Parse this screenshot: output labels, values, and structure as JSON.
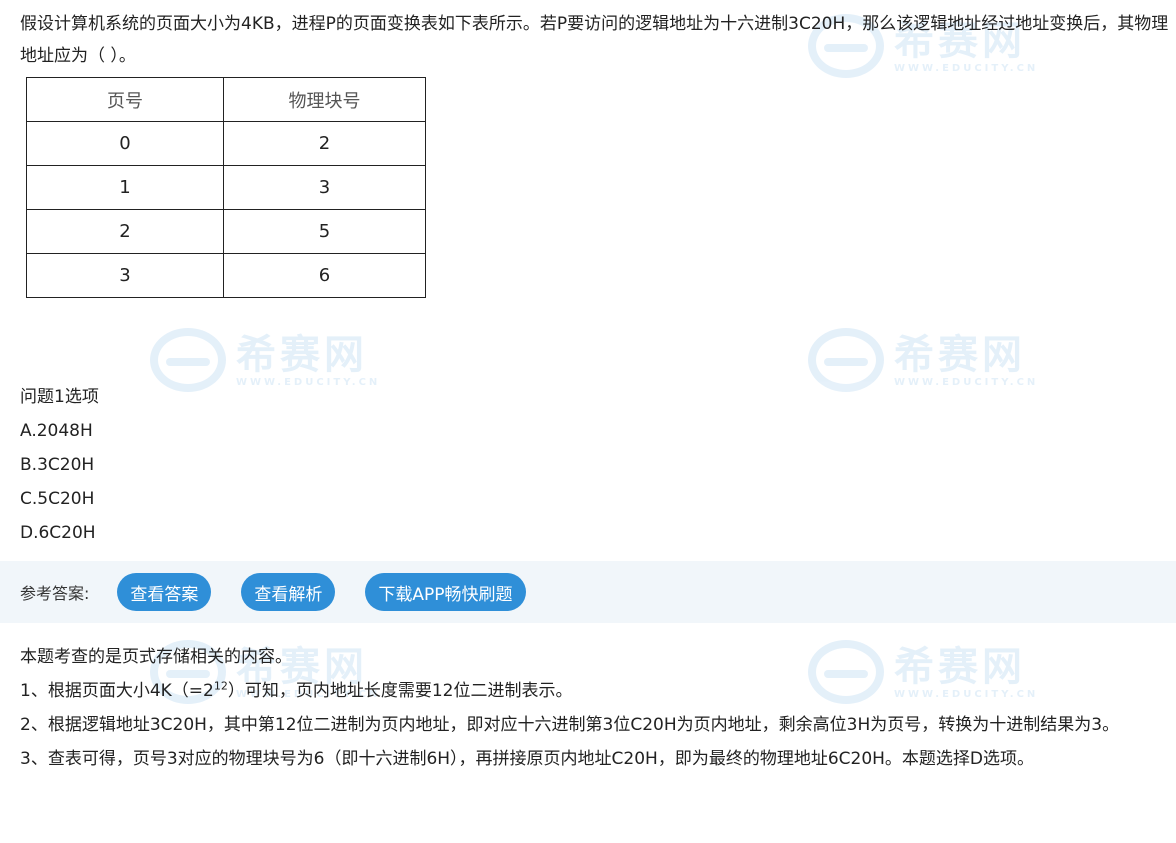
{
  "question": {
    "text": "假设计算机系统的页面大小为4KB，进程P的页面变换表如下表所示。若P要访问的逻辑地址为十六进制3C20H，那么该逻辑地址经过地址变换后，其物理地址应为（  ）。"
  },
  "table": {
    "headers": [
      "页号",
      "物理块号"
    ],
    "rows": [
      [
        "0",
        "2"
      ],
      [
        "1",
        "3"
      ],
      [
        "2",
        "5"
      ],
      [
        "3",
        "6"
      ]
    ]
  },
  "options": {
    "title": "问题1选项",
    "items": [
      "A.2048H",
      "B.3C20H",
      "C.5C20H",
      "D.6C20H"
    ]
  },
  "answer_bar": {
    "label": "参考答案:",
    "view_answer": "查看答案",
    "view_analysis": "查看解析",
    "download_app": "下载APP畅快刷题"
  },
  "analysis": {
    "intro": "本题考查的是页式存储相关的内容。",
    "p1_before": "1、根据页面大小4K（=2",
    "p1_sup": "12",
    "p1_after": "）可知，页内地址长度需要12位二进制表示。",
    "p2": "2、根据逻辑地址3C20H，其中第12位二进制为页内地址，即对应十六进制第3位C20H为页内地址，剩余高位3H为页号，转换为十进制结果为3。",
    "p3": "3、查表可得，页号3对应的物理块号为6（即十六进制6H），再拼接原页内地址C20H，即为最终的物理地址6C20H。本题选择D选项。"
  },
  "watermark": {
    "cn": "希赛网",
    "en": "WWW.EDUCITY.CN"
  },
  "colors": {
    "button": "#2f8fd8",
    "answer_bar_bg": "#f1f6fa",
    "watermark": "#3a8fd6"
  }
}
